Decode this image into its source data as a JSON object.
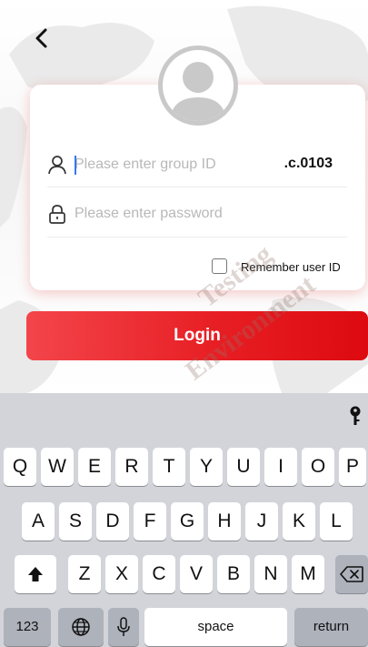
{
  "header": {
    "back_icon": "chevron-left-icon"
  },
  "login_form": {
    "avatar_icon": "user-avatar-icon",
    "group_id": {
      "placeholder": "Please enter group ID",
      "value": "",
      "suffix": ".c.0103",
      "icon": "user-icon"
    },
    "password": {
      "placeholder": "Please enter password",
      "value": "",
      "icon": "lock-icon"
    },
    "remember": {
      "label": "Remember user ID",
      "checked": false
    },
    "login_label": "Login"
  },
  "watermark": {
    "line1": "Testing",
    "line2": "Environment"
  },
  "colors": {
    "accent": "#e71f24",
    "caret": "#3478f6",
    "keyboard_bg": "#d2d4da"
  },
  "keyboard": {
    "row1": [
      "Q",
      "W",
      "E",
      "R",
      "T",
      "Y",
      "U",
      "I",
      "O",
      "P"
    ],
    "row2": [
      "A",
      "S",
      "D",
      "F",
      "G",
      "H",
      "J",
      "K",
      "L"
    ],
    "row3": [
      "Z",
      "X",
      "C",
      "V",
      "B",
      "N",
      "M"
    ],
    "numbers_label": "123",
    "space_label": "space",
    "return_label": "return",
    "icons": {
      "shift": "shift-icon",
      "backspace": "backspace-icon",
      "globe": "globe-icon",
      "mic": "microphone-icon",
      "key": "key-icon"
    }
  }
}
